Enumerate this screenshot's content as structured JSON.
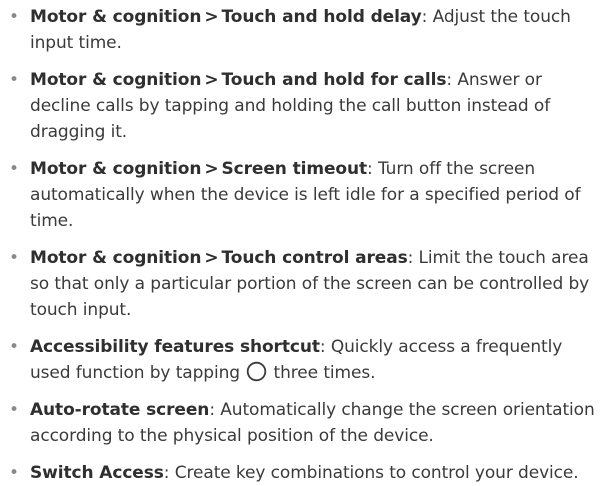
{
  "items": [
    {
      "path": "Motor & cognition",
      "separator": ">",
      "term": "Touch and hold delay",
      "colon": ":",
      "description": " Adjust the touch input time."
    },
    {
      "path": "Motor & cognition",
      "separator": ">",
      "term": "Touch and hold for calls",
      "colon": ":",
      "description": " Answer or decline calls by tapping and holding the call button instead of dragging it."
    },
    {
      "path": "Motor & cognition",
      "separator": ">",
      "term": "Screen timeout",
      "colon": ":",
      "description": " Turn off the screen automatically when the device is left idle for a specified period of time."
    },
    {
      "path": "Motor & cognition",
      "separator": ">",
      "term": "Touch control areas",
      "colon": ":",
      "description": " Limit the touch area so that only a particular portion of the screen can be controlled by touch input."
    },
    {
      "term": "Accessibility features shortcut",
      "colon": ":",
      "description_before_icon": " Quickly access a frequently used function by tapping ",
      "icon": "home-button-circle-icon",
      "description_after_icon": " three times."
    },
    {
      "term": "Auto-rotate screen",
      "colon": ":",
      "description": " Automatically change the screen orientation according to the physical position of the device."
    },
    {
      "term": "Switch Access",
      "colon": ":",
      "description": " Create key combinations to control your device."
    }
  ],
  "bullet": "•",
  "colors": {
    "text": "#3a3a3a",
    "term": "#2f2f2f",
    "bullet": "#8a8a8a"
  }
}
